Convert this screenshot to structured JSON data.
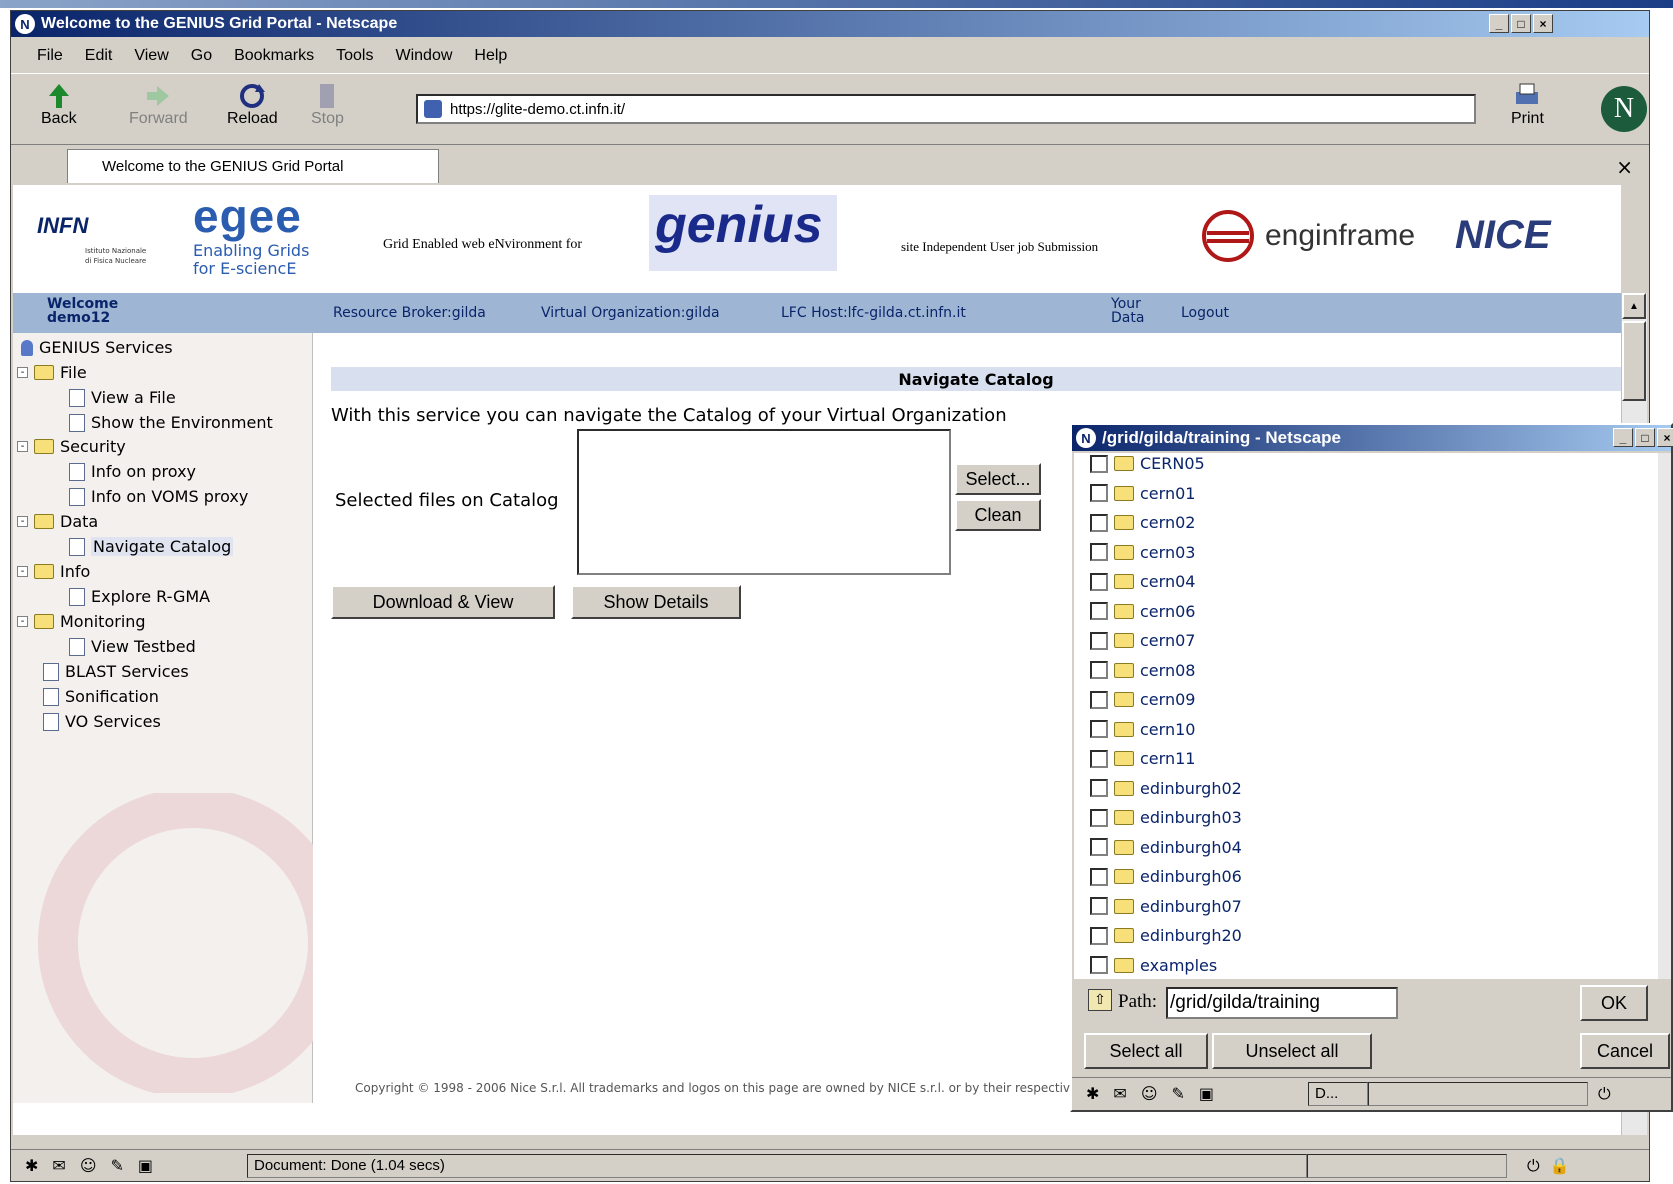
{
  "main_window": {
    "title": "Welcome to the GENIUS Grid Portal - Netscape",
    "menu": [
      "File",
      "Edit",
      "View",
      "Go",
      "Bookmarks",
      "Tools",
      "Window",
      "Help"
    ],
    "toolbar": {
      "back": "Back",
      "forward": "Forward",
      "reload": "Reload",
      "stop": "Stop",
      "print": "Print",
      "url": "https://glite-demo.ct.infn.it/"
    },
    "tab_title": "Welcome to the GENIUS Grid Portal",
    "tab_close": "×",
    "status": "Document: Done (1.04 secs)"
  },
  "header": {
    "infn": "INFN",
    "infn_sub1": "Istituto Nazionale",
    "infn_sub2": "di Fisica Nucleare",
    "egee": "egee",
    "egee_line1": "Enabling Grids",
    "egee_line2": "for E-sciencE",
    "genius_text": "Grid Enabled web eNvironment for",
    "genius_logo": "genius",
    "site_text": "site Independent User job Submission",
    "enginframe": "enginframe",
    "nice": "NICE"
  },
  "bluebar": {
    "welcome": "Welcome",
    "user": "demo12",
    "broker": "Resource Broker:gilda",
    "vo": "Virtual Organization:gilda",
    "lfc": "LFC Host:lfc-gilda.ct.infn.it",
    "your": "Your",
    "data": "Data",
    "logout": "Logout"
  },
  "tree": {
    "root": "GENIUS Services",
    "items": [
      "File",
      "View a File",
      "Show the Environment",
      "Security",
      "Info on proxy",
      "Info on VOMS proxy",
      "Data",
      "Navigate Catalog",
      "Info",
      "Explore R-GMA",
      "Monitoring",
      "View Testbed",
      "BLAST Services",
      "Sonification",
      "VO Services"
    ]
  },
  "main": {
    "section_title": "Navigate Catalog",
    "intro": "With this service you can navigate the Catalog of your Virtual Organization",
    "selected_label": "Selected files on Catalog",
    "select_btn": "Select...",
    "clean_btn": "Clean",
    "download_btn": "Download & View",
    "details_btn": "Show Details",
    "copyright": "Copyright © 1998 - 2006 Nice S.r.l. All trademarks and logos on this page are owned by NICE s.r.l. or by their respective owners."
  },
  "popup": {
    "title": "/grid/gilda/training - Netscape",
    "files": [
      "CERN05",
      "cern01",
      "cern02",
      "cern03",
      "cern04",
      "cern06",
      "cern07",
      "cern08",
      "cern09",
      "cern10",
      "cern11",
      "edinburgh02",
      "edinburgh03",
      "edinburgh04",
      "edinburgh06",
      "edinburgh07",
      "edinburgh20",
      "examples"
    ],
    "path_label": "Path:",
    "path_value": "/grid/gilda/training",
    "ok": "OK",
    "select_all": "Select all",
    "unselect_all": "Unselect all",
    "cancel": "Cancel",
    "status": "D..."
  },
  "colors": {
    "titlebar": "#0a246a",
    "bluebar": "#9eb6d4",
    "chrome": "#d4d0c8"
  }
}
